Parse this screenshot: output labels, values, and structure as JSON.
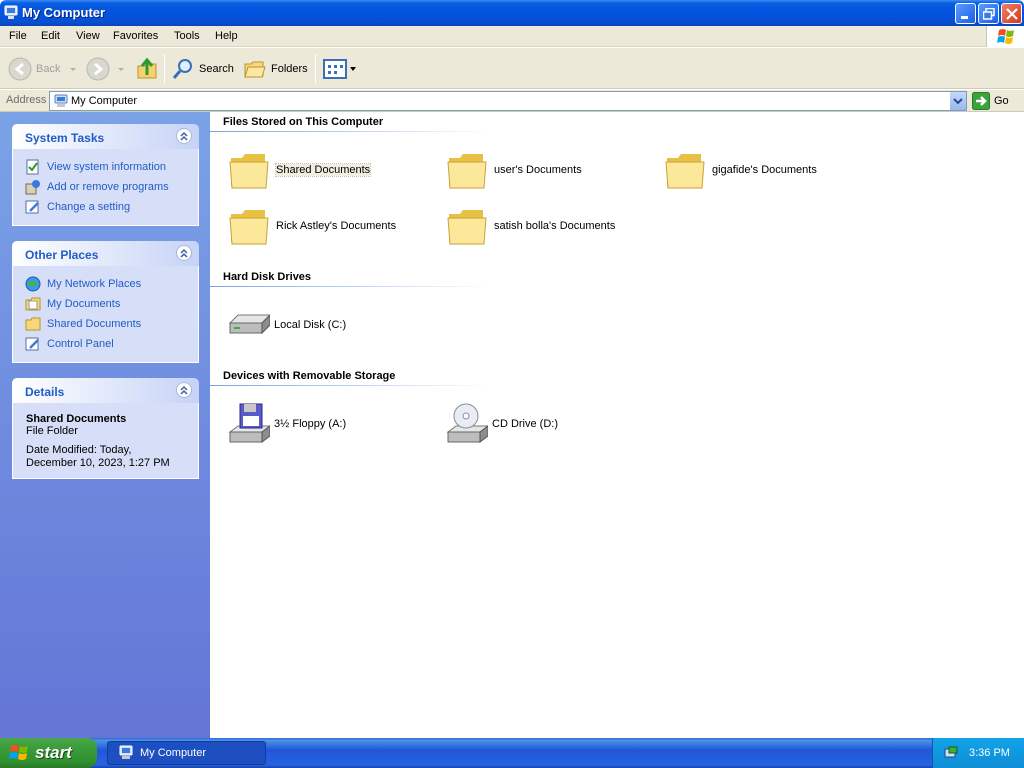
{
  "window": {
    "title": "My Computer"
  },
  "menu": [
    "File",
    "Edit",
    "View",
    "Favorites",
    "Tools",
    "Help"
  ],
  "toolbar": {
    "back_label": "Back",
    "search_label": "Search",
    "folders_label": "Folders"
  },
  "address": {
    "label": "Address",
    "value": "My Computer",
    "go_label": "Go"
  },
  "left_panel": {
    "system_tasks": {
      "title": "System Tasks",
      "items": [
        "View system information",
        "Add or remove programs",
        "Change a setting"
      ]
    },
    "other_places": {
      "title": "Other Places",
      "items": [
        "My Network Places",
        "My Documents",
        "Shared Documents",
        "Control Panel"
      ]
    },
    "details": {
      "title": "Details",
      "name": "Shared Documents",
      "type": "File Folder",
      "modified_line1": "Date Modified: Today,",
      "modified_line2": "December 10, 2023, 1:27 PM"
    }
  },
  "main": {
    "files_section": {
      "title": "Files Stored on This Computer",
      "items": [
        "Shared Documents",
        "user's Documents",
        "gigafide's Documents",
        "Rick Astley's Documents",
        "satish bolla's Documents"
      ]
    },
    "hdd_section": {
      "title": "Hard Disk Drives",
      "items": [
        "Local Disk (C:)"
      ]
    },
    "removable_section": {
      "title": "Devices with Removable Storage",
      "items": [
        "3½ Floppy (A:)",
        "CD Drive (D:)"
      ]
    }
  },
  "taskbar": {
    "start_label": "start",
    "task_label": "My Computer",
    "clock": "3:36 PM"
  }
}
